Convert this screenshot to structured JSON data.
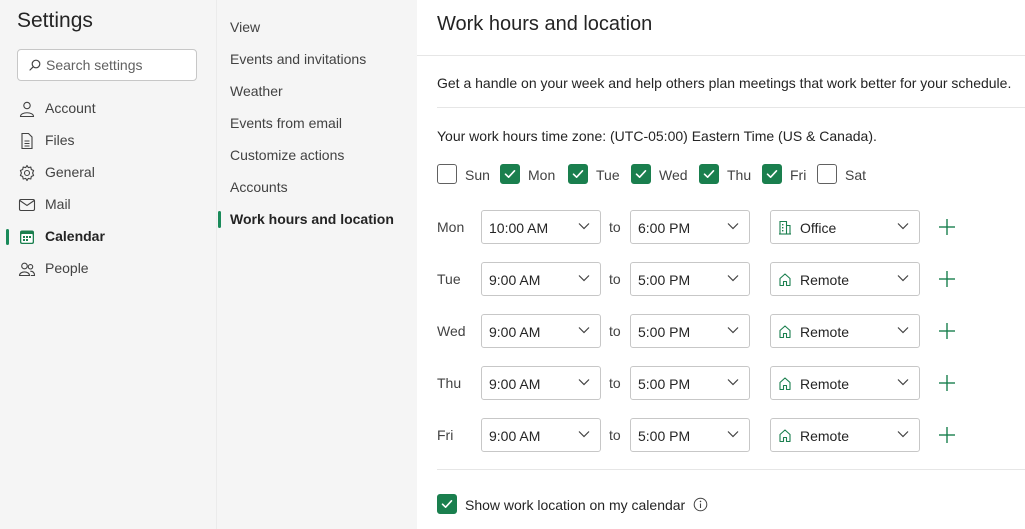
{
  "settings": {
    "title": "Settings",
    "search_placeholder": "Search settings"
  },
  "nav": {
    "items": [
      {
        "label": "Account",
        "icon": "person-icon"
      },
      {
        "label": "Files",
        "icon": "file-icon"
      },
      {
        "label": "General",
        "icon": "gear-icon"
      },
      {
        "label": "Mail",
        "icon": "mail-icon"
      },
      {
        "label": "Calendar",
        "icon": "calendar-icon",
        "active": true
      },
      {
        "label": "People",
        "icon": "people-icon"
      }
    ]
  },
  "subnav": {
    "items": [
      {
        "label": "View"
      },
      {
        "label": "Events and invitations"
      },
      {
        "label": "Weather"
      },
      {
        "label": "Events from email"
      },
      {
        "label": "Customize actions"
      },
      {
        "label": "Accounts"
      },
      {
        "label": "Work hours and location",
        "active": true
      }
    ]
  },
  "main": {
    "title": "Work hours and location",
    "description": "Get a handle on your week and help others plan meetings that work better for your schedule.",
    "timezone_text": "Your work hours time zone: (UTC-05:00) Eastern Time (US & Canada).",
    "days": [
      {
        "label": "Sun",
        "checked": false
      },
      {
        "label": "Mon",
        "checked": true
      },
      {
        "label": "Tue",
        "checked": true
      },
      {
        "label": "Wed",
        "checked": true
      },
      {
        "label": "Thu",
        "checked": true
      },
      {
        "label": "Fri",
        "checked": true
      },
      {
        "label": "Sat",
        "checked": false
      }
    ],
    "to_label": "to",
    "schedule": [
      {
        "day": "Mon",
        "start": "10:00 AM",
        "end": "6:00 PM",
        "location": "Office",
        "location_icon": "building-icon"
      },
      {
        "day": "Tue",
        "start": "9:00 AM",
        "end": "5:00 PM",
        "location": "Remote",
        "location_icon": "home-icon"
      },
      {
        "day": "Wed",
        "start": "9:00 AM",
        "end": "5:00 PM",
        "location": "Remote",
        "location_icon": "home-icon"
      },
      {
        "day": "Thu",
        "start": "9:00 AM",
        "end": "5:00 PM",
        "location": "Remote",
        "location_icon": "home-icon"
      },
      {
        "day": "Fri",
        "start": "9:00 AM",
        "end": "5:00 PM",
        "location": "Remote",
        "location_icon": "home-icon"
      }
    ],
    "show_location": {
      "label": "Show work location on my calendar",
      "checked": true
    }
  },
  "colors": {
    "accent": "#1a7f4e",
    "nav_bg": "#f5f5f5",
    "border": "#c7c7c7"
  }
}
